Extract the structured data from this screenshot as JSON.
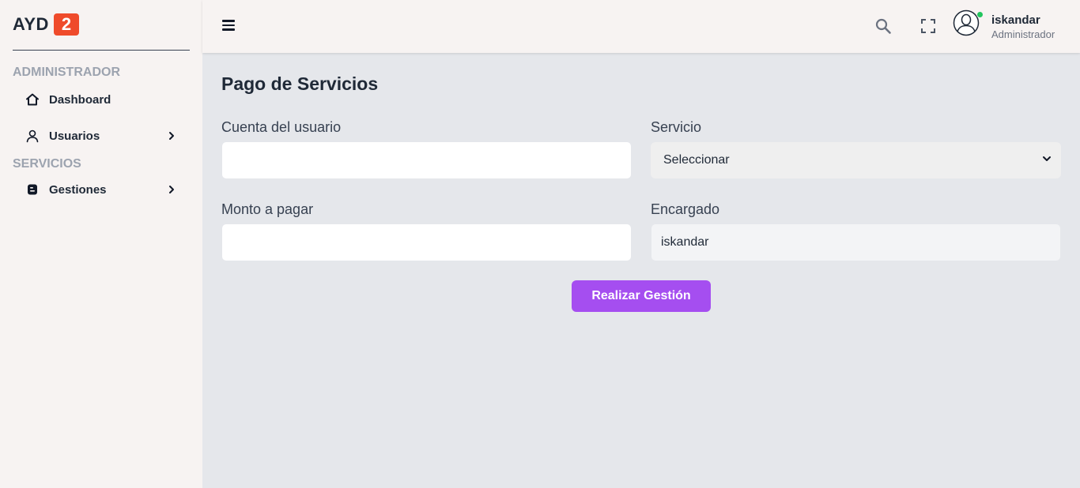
{
  "brand": {
    "name": "AYD",
    "badge": "2"
  },
  "sidebar": {
    "sections": [
      {
        "label": "ADMINISTRADOR"
      },
      {
        "label": "SERVICIOS"
      }
    ],
    "items": [
      {
        "label": "Dashboard",
        "icon": "home-icon",
        "has_children": false
      },
      {
        "label": "Usuarios",
        "icon": "user-icon",
        "has_children": true
      },
      {
        "label": "Gestiones",
        "icon": "blogger-icon",
        "has_children": true
      }
    ]
  },
  "header": {
    "icons": [
      "menu-icon",
      "search-icon",
      "fullscreen-icon",
      "avatar-icon"
    ],
    "user": {
      "name": "iskandar",
      "role": "Administrador",
      "status": "online"
    }
  },
  "main": {
    "title": "Pago de Servicios",
    "form": {
      "account_label": "Cuenta del usuario",
      "account_value": "",
      "service_label": "Servicio",
      "service_selected": "Seleccionar",
      "amount_label": "Monto a pagar",
      "amount_value": "",
      "manager_label": "Encargado",
      "manager_value": "iskandar",
      "submit_label": "Realizar Gestión"
    }
  },
  "colors": {
    "accent": "#a54ef0",
    "brand_badge": "#ef4b2b",
    "online": "#22c55e",
    "sidebar_bg": "#f7f3f2",
    "main_bg": "#e5e7eb"
  }
}
